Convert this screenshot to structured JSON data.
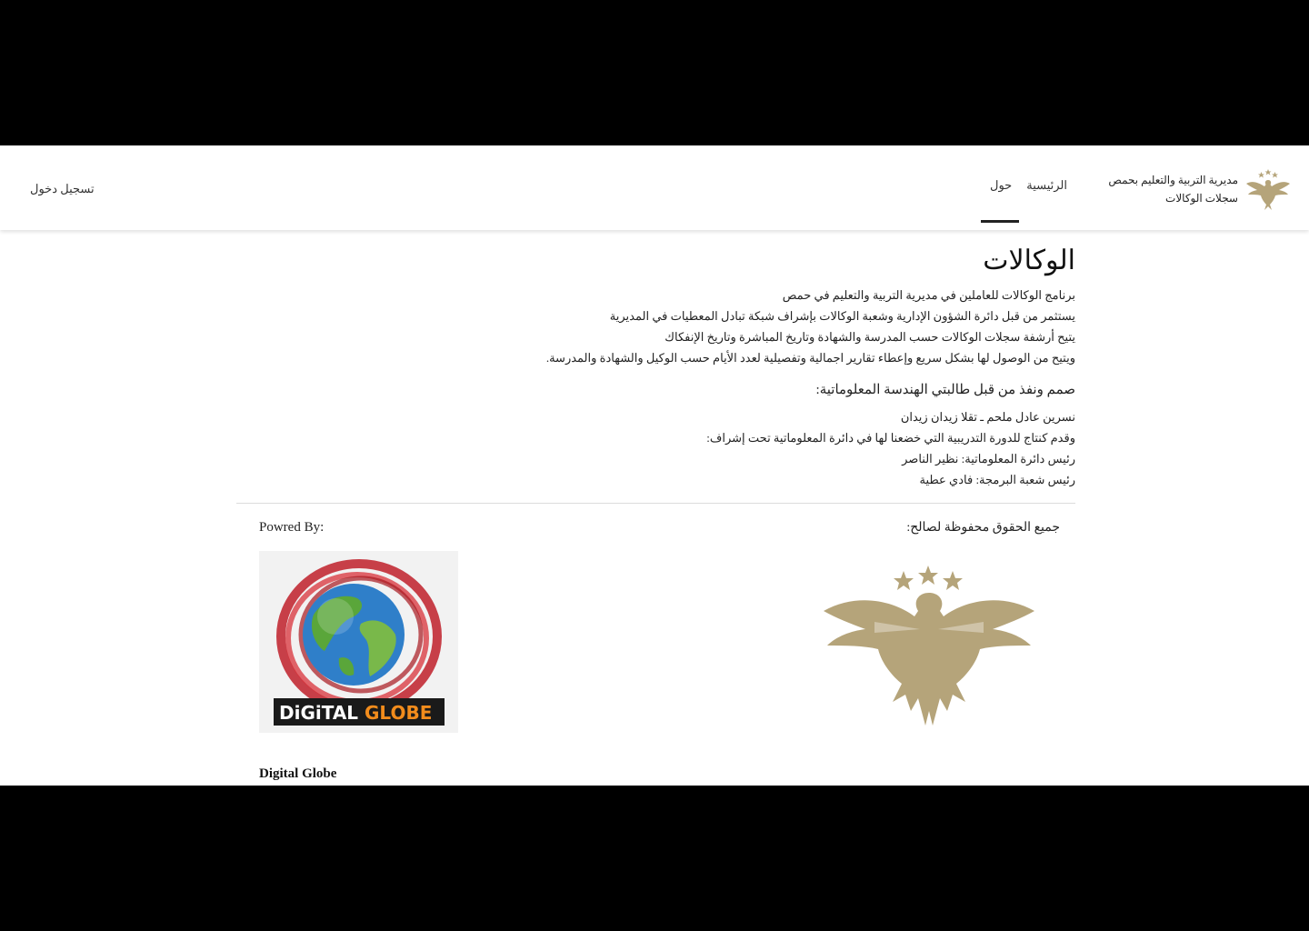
{
  "header": {
    "brand_line1": "مديرية التربية والتعليم بحمص",
    "brand_line2": "سجلات الوكالات",
    "nav": [
      {
        "label": "الرئيسية"
      },
      {
        "label": "حول"
      }
    ],
    "login_label": "تسجيل دخول"
  },
  "main": {
    "title": "الوكالات",
    "description_lines": [
      "برنامج الوكالات للعاملين في مديرية التربية والتعليم في حمص",
      "يستثمر من قبل دائرة الشؤون الإدارية وشعبة الوكالات بإشراف شبكة تبادل المعطيات في المديرية",
      "يتيح أرشفة سجلات الوكالات حسب المدرسة والشهادة وتاريخ المباشرة وتاريخ الإنفكاك",
      "ويتيح من الوصول لها بشكل سريع وإعطاء تقارير اجمالية وتفصيلية لعدد الأيام حسب الوكيل والشهادة والمدرسة."
    ],
    "designed_by_heading": "صمم ونفذ من قبل طالبتي الهندسة المعلوماتية:",
    "credit_lines": [
      "نسرين عادل ملحم ـ تقلا زيدان زيدان",
      "وقدم كنتاج للدورة التدريبية التي خضعنا لها في دائرة المعلوماتية تحت إشراف:",
      "رئيس دائرة المعلوماتية: نظير الناصر",
      "رئيس شعبة البرمجة: فادي عطية"
    ]
  },
  "footer": {
    "rights_label": "جميع الحقوق محفوظة لصالح:",
    "powered_label": "Powred By:",
    "company_name": "Digital Globe",
    "logo_text_left": "DiGiTAL",
    "logo_text_right": "GLOBE"
  },
  "colors": {
    "eagle_gold": "#b5a47a",
    "accent_dark": "#222222",
    "globe_red": "#c0202a",
    "logo_orange": "#f28c1c"
  }
}
